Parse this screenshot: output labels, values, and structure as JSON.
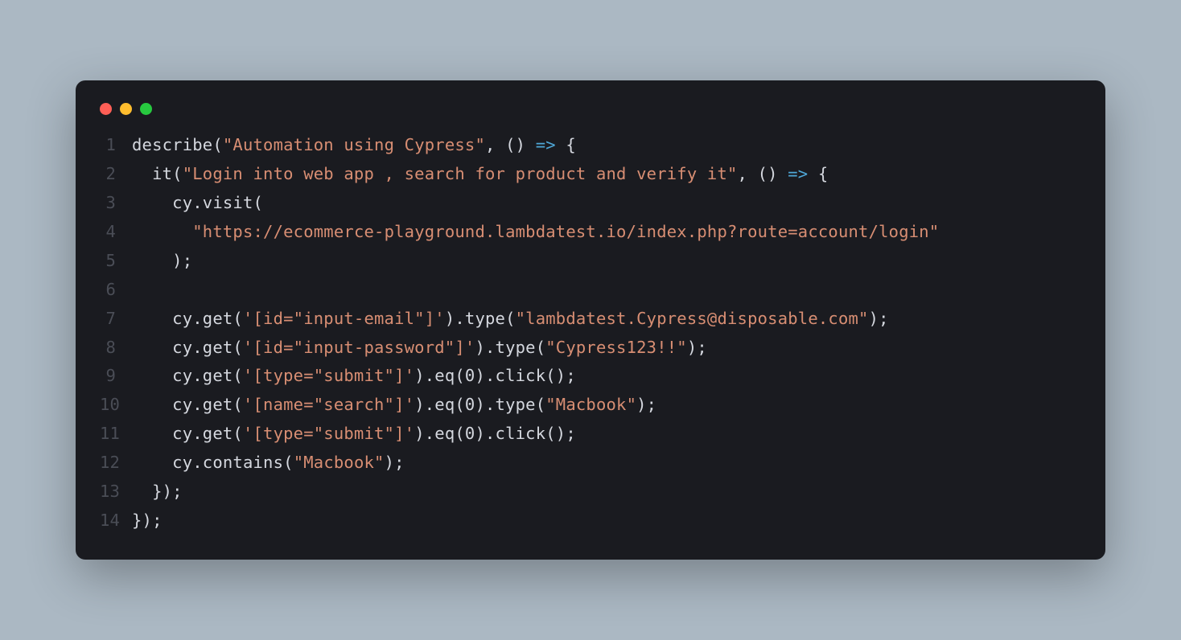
{
  "lines": [
    {
      "num": "1",
      "tokens": [
        {
          "t": "describe(",
          "c": "punct"
        },
        {
          "t": "\"Automation using Cypress\"",
          "c": "string"
        },
        {
          "t": ", () ",
          "c": "punct"
        },
        {
          "t": "=>",
          "c": "arrow"
        },
        {
          "t": " {",
          "c": "punct"
        }
      ]
    },
    {
      "num": "2",
      "tokens": [
        {
          "t": "  it(",
          "c": "punct"
        },
        {
          "t": "\"Login into web app , search for product and verify it\"",
          "c": "string"
        },
        {
          "t": ", () ",
          "c": "punct"
        },
        {
          "t": "=>",
          "c": "arrow"
        },
        {
          "t": " {",
          "c": "punct"
        }
      ]
    },
    {
      "num": "3",
      "tokens": [
        {
          "t": "    cy.visit(",
          "c": "punct"
        }
      ]
    },
    {
      "num": "4",
      "tokens": [
        {
          "t": "      ",
          "c": "punct"
        },
        {
          "t": "\"https://ecommerce-playground.lambdatest.io/index.php?route=account/login\"",
          "c": "string"
        }
      ]
    },
    {
      "num": "5",
      "tokens": [
        {
          "t": "    );",
          "c": "punct"
        }
      ]
    },
    {
      "num": "6",
      "tokens": [
        {
          "t": "",
          "c": "punct"
        }
      ]
    },
    {
      "num": "7",
      "tokens": [
        {
          "t": "    cy.get(",
          "c": "punct"
        },
        {
          "t": "'[id=\"input-email\"]'",
          "c": "string"
        },
        {
          "t": ").type(",
          "c": "punct"
        },
        {
          "t": "\"lambdatest.Cypress@disposable.com\"",
          "c": "string"
        },
        {
          "t": ");",
          "c": "punct"
        }
      ]
    },
    {
      "num": "8",
      "tokens": [
        {
          "t": "    cy.get(",
          "c": "punct"
        },
        {
          "t": "'[id=\"input-password\"]'",
          "c": "string"
        },
        {
          "t": ").type(",
          "c": "punct"
        },
        {
          "t": "\"Cypress123!!\"",
          "c": "string"
        },
        {
          "t": ");",
          "c": "punct"
        }
      ]
    },
    {
      "num": "9",
      "tokens": [
        {
          "t": "    cy.get(",
          "c": "punct"
        },
        {
          "t": "'[type=\"submit\"]'",
          "c": "string"
        },
        {
          "t": ").eq(0).click();",
          "c": "punct"
        }
      ]
    },
    {
      "num": "10",
      "tokens": [
        {
          "t": "    cy.get(",
          "c": "punct"
        },
        {
          "t": "'[name=\"search\"]'",
          "c": "string"
        },
        {
          "t": ").eq(0).type(",
          "c": "punct"
        },
        {
          "t": "\"Macbook\"",
          "c": "string"
        },
        {
          "t": ");",
          "c": "punct"
        }
      ]
    },
    {
      "num": "11",
      "tokens": [
        {
          "t": "    cy.get(",
          "c": "punct"
        },
        {
          "t": "'[type=\"submit\"]'",
          "c": "string"
        },
        {
          "t": ").eq(0).click();",
          "c": "punct"
        }
      ]
    },
    {
      "num": "12",
      "tokens": [
        {
          "t": "    cy.contains(",
          "c": "punct"
        },
        {
          "t": "\"Macbook\"",
          "c": "string"
        },
        {
          "t": ");",
          "c": "punct"
        }
      ]
    },
    {
      "num": "13",
      "tokens": [
        {
          "t": "  });",
          "c": "punct"
        }
      ]
    },
    {
      "num": "14",
      "tokens": [
        {
          "t": "});",
          "c": "punct"
        }
      ]
    }
  ]
}
